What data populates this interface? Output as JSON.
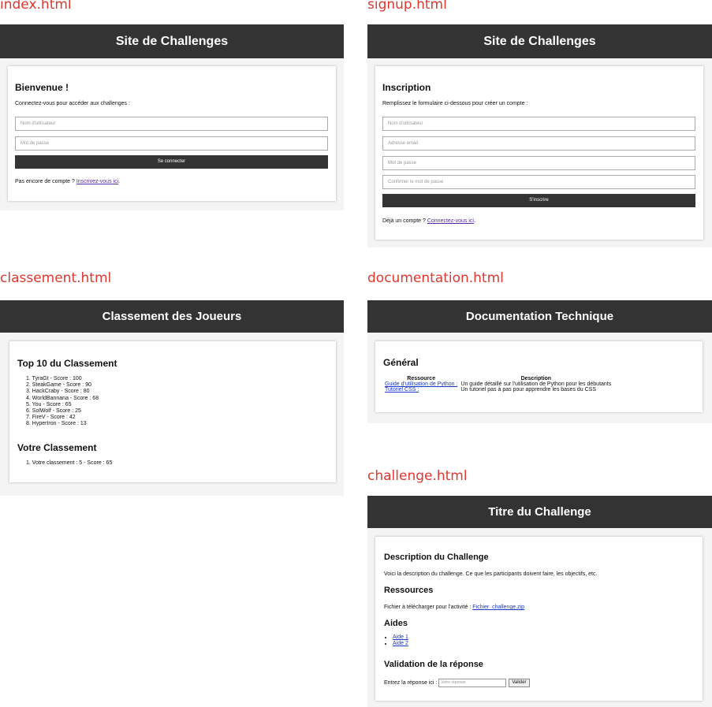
{
  "labels": {
    "index": "index.html",
    "signup": "signup.html",
    "classement": "classement.html",
    "documentation": "documentation.html",
    "challenge": "challenge.html"
  },
  "index_page": {
    "header": "Site de Challenges",
    "title": "Bienvenue !",
    "intro": "Connectez-vous pour accéder aux challenges :",
    "username_placeholder": "Nom d'utilisateur",
    "password_placeholder": "Mot de passe",
    "login_button": "Se connecter",
    "footer_text": "Pas encore de compte ?",
    "footer_link": "Inscrivez-vous ici"
  },
  "signup_page": {
    "header": "Site de Challenges",
    "title": "Inscription",
    "intro": "Remplissez le formulaire ci-dessous pour créer un compte :",
    "username_placeholder": "Nom d'utilisateur",
    "email_placeholder": "Adresse email",
    "password_placeholder": "Mot de passe",
    "confirm_placeholder": "Confirmer le mot de passe",
    "signup_button": "S'inscrire",
    "footer_text": "Déjà un compte ?",
    "footer_link": "Connectez-vous ici"
  },
  "classement_page": {
    "header": "Classement des Joueurs",
    "top_title": "Top 10 du Classement",
    "ranking": [
      "1. TyraGt - Score : 100",
      "2. SteakGame - Score : 90",
      "3. HackCraby - Score : 80",
      "4. WorldBannana - Score : 68",
      "5. You - Score : 65",
      "6. SolWolf - Score : 25",
      "7. FireV - Score : 42",
      "8. HyperIron - Score : 13"
    ],
    "your_title": "Votre Classement",
    "your_rank": "1. Votre classement : 5 - Score : 65"
  },
  "documentation_page": {
    "header": "Documentation Technique",
    "section_title": "Général",
    "columns": [
      "Ressource",
      "Description"
    ],
    "rows": [
      {
        "resource": "Guide d'utilisation de Python :",
        "description": "Un guide détaillé sur l'utilisation de Python pour les débutants"
      },
      {
        "resource": "Tutoriel CSS :",
        "description": "Un tutoriel pas à pas pour apprendre les bases du CSS"
      }
    ]
  },
  "challenge_page": {
    "header": "Titre du Challenge",
    "desc_title": "Description du Challenge",
    "desc_text": "Voici la description du challenge. Ce que les participants doivent faire, les objectifs, etc.",
    "res_title": "Ressources",
    "res_text": "Fichier à télécharger pour l'activité :",
    "res_link": "Fichier_challenge.zip",
    "help_title": "Aides",
    "help_items": [
      "Aide 1",
      "Aide 2"
    ],
    "valid_title": "Validation de la réponse",
    "valid_label": "Entrez la réponse ici :",
    "answer_placeholder": "Votre réponse",
    "submit_button": "Valider"
  }
}
